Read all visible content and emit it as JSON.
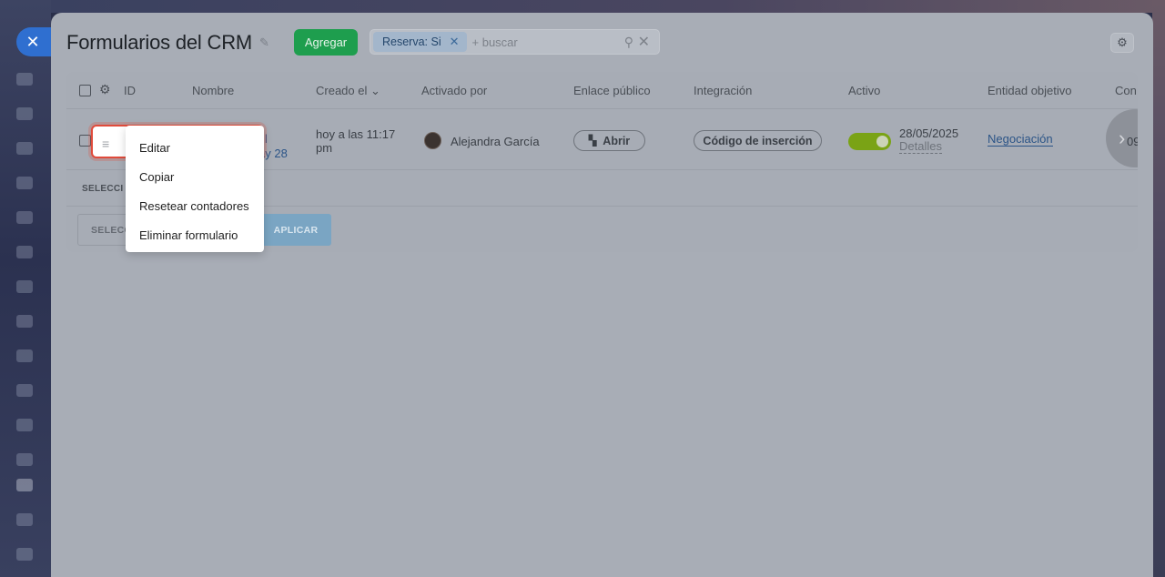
{
  "window": {
    "close_label": "✕"
  },
  "page": {
    "title": "Formularios del CRM",
    "add_label": "Agregar",
    "settings_icon": "gear-icon"
  },
  "filter": {
    "chip_label": "Reserva: Si",
    "placeholder": "+ buscar"
  },
  "table": {
    "headers": {
      "id": "ID",
      "name": "Nombre",
      "created": "Creado el",
      "activated_by": "Activado por",
      "public_link": "Enlace público",
      "integration": "Integración",
      "active": "Activo",
      "target_entity": "Entidad objetivo",
      "cut": "Con"
    },
    "row": {
      "name_fragment_1": "l",
      "name_fragment_2": "ay 28",
      "created_line1": "hoy a las 11:17",
      "created_line2": "pm",
      "activated_by": "Alejandra García",
      "open_label": "Abrir",
      "embed_label": "Código de inserción",
      "active_on": true,
      "active_date": "28/05/2025",
      "details_label": "Detalles",
      "entity_label": "Negociación",
      "cut_value": "09"
    },
    "footer": {
      "selected_label": "SELECCI",
      "select_action_label": "SELECC",
      "apply_label": "APLICAR"
    }
  },
  "context_menu": {
    "items": [
      "Editar",
      "Copiar",
      "Resetear contadores",
      "Eliminar formulario"
    ]
  },
  "colors": {
    "accent_green": "#1e9e4e",
    "highlight_red": "#e04b3b",
    "toggle_on": "#7aa315"
  }
}
